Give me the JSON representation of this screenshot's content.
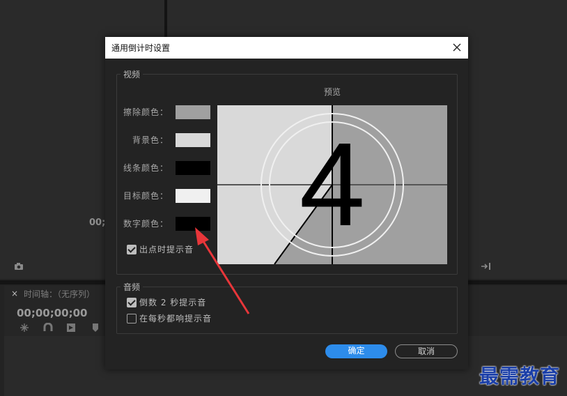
{
  "background": {
    "timecode_partial": "00;0",
    "timeline_tab_close": "×",
    "timeline_title": "时间轴：（无序列）",
    "timeline_timecode": "00;00;00;00"
  },
  "dialog": {
    "title": "通用倒计时设置",
    "video_group": {
      "legend": "视频",
      "rows": [
        {
          "label": "擦除颜色：",
          "color": "#a0a0a0"
        },
        {
          "label": "背景色：",
          "color": "#d9d9d9"
        },
        {
          "label": "线条颜色：",
          "color": "#000000"
        },
        {
          "label": "目标颜色：",
          "color": "#f0f0f0"
        },
        {
          "label": "数字颜色：",
          "color": "#000000"
        }
      ],
      "cue_checkbox_label": "出点时提示音",
      "cue_checked": true
    },
    "preview": {
      "label": "预览",
      "digit": "4"
    },
    "audio_group": {
      "legend": "音频",
      "options": [
        {
          "label": "倒数 2 秒提示音",
          "checked": true
        },
        {
          "label": "在每秒都响提示音",
          "checked": false
        }
      ]
    },
    "ok_label": "确定",
    "cancel_label": "取消"
  },
  "watermark": "最需教育",
  "colors": {
    "accent": "#2d8ceb",
    "arrow": "#e8363a"
  }
}
